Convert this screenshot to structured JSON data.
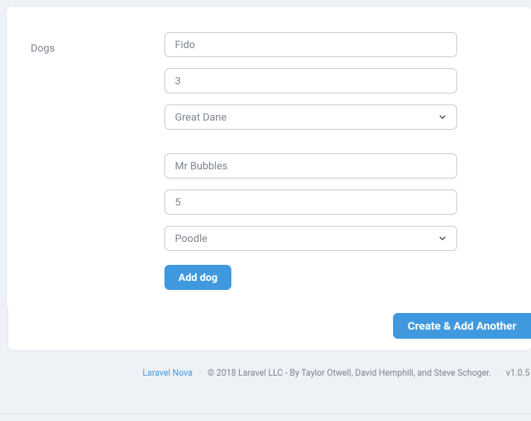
{
  "field": {
    "label": "Dogs"
  },
  "dogs": [
    {
      "name": "Fido",
      "number": "3",
      "breed": "Great Dane"
    },
    {
      "name": "Mr Bubbles",
      "number": "5",
      "breed": "Poodle"
    }
  ],
  "add_button": "Add dog",
  "create_button": "Create & Add Another",
  "footer": {
    "link": "Laravel Nova",
    "copyright": "© 2018 Laravel LLC - By Taylor Otwell, David Hemphill, and Steve Schoger.",
    "version": "v1.0.5"
  }
}
